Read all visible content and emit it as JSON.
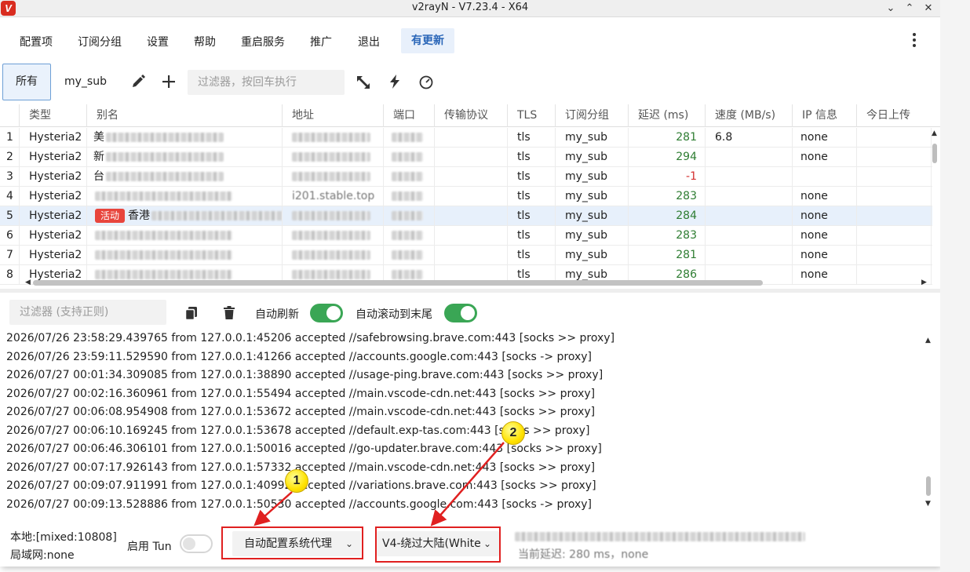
{
  "window": {
    "title": "v2rayN - V7.23.4 - X64",
    "logo_letter": "V",
    "controls": [
      "chevron-down",
      "chevron-up",
      "close"
    ]
  },
  "menu": {
    "items": [
      "配置项",
      "订阅分组",
      "设置",
      "帮助",
      "重启服务",
      "推广",
      "退出"
    ],
    "update_label": "有更新"
  },
  "toolbar": {
    "tab_all": "所有",
    "tab_sub": "my_sub",
    "icons": [
      "edit-icon",
      "add-icon",
      "resize-icon",
      "speedtest-icon",
      "gauge-icon"
    ],
    "filter_placeholder": "过滤器，按回车执行"
  },
  "table": {
    "columns": [
      "类型",
      "别名",
      "地址",
      "端口",
      "传输协议",
      "TLS",
      "订阅分组",
      "延迟 (ms)",
      "速度 (MB/s)",
      "IP 信息",
      "今日上传"
    ],
    "rows": [
      {
        "n": "1",
        "type": "Hysteria2",
        "alias_prefix": "美",
        "address_visible": "",
        "tls": "tls",
        "sub": "my_sub",
        "delay": "281",
        "speed": "6.8",
        "ip": "none"
      },
      {
        "n": "2",
        "type": "Hysteria2",
        "alias_prefix": "新",
        "address_visible": "",
        "tls": "tls",
        "sub": "my_sub",
        "delay": "294",
        "speed": "",
        "ip": "none"
      },
      {
        "n": "3",
        "type": "Hysteria2",
        "alias_prefix": "台",
        "address_visible": "",
        "tls": "tls",
        "sub": "my_sub",
        "delay": "-1",
        "speed": "",
        "ip": ""
      },
      {
        "n": "4",
        "type": "Hysteria2",
        "alias_prefix": "",
        "address_visible": "i201.stable.top",
        "tls": "tls",
        "sub": "my_sub",
        "delay": "283",
        "speed": "",
        "ip": "none"
      },
      {
        "n": "5",
        "type": "Hysteria2",
        "alias_prefix": "香港",
        "badge": "活动",
        "address_visible": "",
        "tls": "tls",
        "sub": "my_sub",
        "delay": "284",
        "speed": "",
        "ip": "none",
        "selected": true
      },
      {
        "n": "6",
        "type": "Hysteria2",
        "alias_prefix": "",
        "address_visible": "",
        "tls": "tls",
        "sub": "my_sub",
        "delay": "283",
        "speed": "",
        "ip": "none"
      },
      {
        "n": "7",
        "type": "Hysteria2",
        "alias_prefix": "",
        "address_visible": "",
        "tls": "tls",
        "sub": "my_sub",
        "delay": "281",
        "speed": "",
        "ip": "none"
      },
      {
        "n": "8",
        "type": "Hysteria2",
        "alias_prefix": "",
        "address_visible": "",
        "tls": "tls",
        "sub": "my_sub",
        "delay": "286",
        "speed": "",
        "ip": "none"
      }
    ]
  },
  "log": {
    "filter_placeholder": "过滤器 (支持正则)",
    "auto_refresh_label": "自动刷新",
    "auto_refresh_on": true,
    "auto_scroll_label": "自动滚动到末尾",
    "auto_scroll_on": true,
    "lines": [
      "2026/07/26 23:58:29.439765 from 127.0.0.1:45206 accepted //safebrowsing.brave.com:443 [socks >> proxy]",
      "2026/07/26 23:59:11.529590 from 127.0.0.1:41266 accepted //accounts.google.com:443 [socks -> proxy]",
      "2026/07/27 00:01:34.309085 from 127.0.0.1:38890 accepted //usage-ping.brave.com:443 [socks >> proxy]",
      "2026/07/27 00:02:16.360961 from 127.0.0.1:55494 accepted //main.vscode-cdn.net:443 [socks >> proxy]",
      "2026/07/27 00:06:08.954908 from 127.0.0.1:53672 accepted //main.vscode-cdn.net:443 [socks >> proxy]",
      "2026/07/27 00:06:10.169245 from 127.0.0.1:53678 accepted //default.exp-tas.com:443 [socks >> proxy]",
      "2026/07/27 00:06:46.306101 from 127.0.0.1:50016 accepted //go-updater.brave.com:443 [socks >> proxy]",
      "2026/07/27 00:07:17.926143 from 127.0.0.1:57332 accepted //main.vscode-cdn.net:443 [socks >> proxy]",
      "2026/07/27 00:09:07.911991 from 127.0.0.1:40992 accepted //variations.brave.com:443 [socks >> proxy]",
      "2026/07/27 00:09:13.528886 from 127.0.0.1:50530 accepted //accounts.google.com:443 [socks -> proxy]"
    ]
  },
  "status": {
    "local": "本地:[mixed:10808]",
    "lan": "局域网:none",
    "tun_label": "启用 Tun",
    "tun_on": false,
    "sysproxy_value": "自动配置系统代理",
    "routing_value": "V4-绕过大陆(White",
    "current_delay": "当前延迟: 280 ms，none"
  },
  "annotations": {
    "callout_1": "1",
    "callout_2": "2",
    "highlight_color": "#e02020",
    "callout_color": "#ffe200"
  },
  "colors": {
    "accent": "#2a66b8",
    "toggle_on": "#3aa655",
    "delay_ok": "#2e7d32",
    "delay_bad": "#d32f2f",
    "active_badge": "#e8453c"
  }
}
